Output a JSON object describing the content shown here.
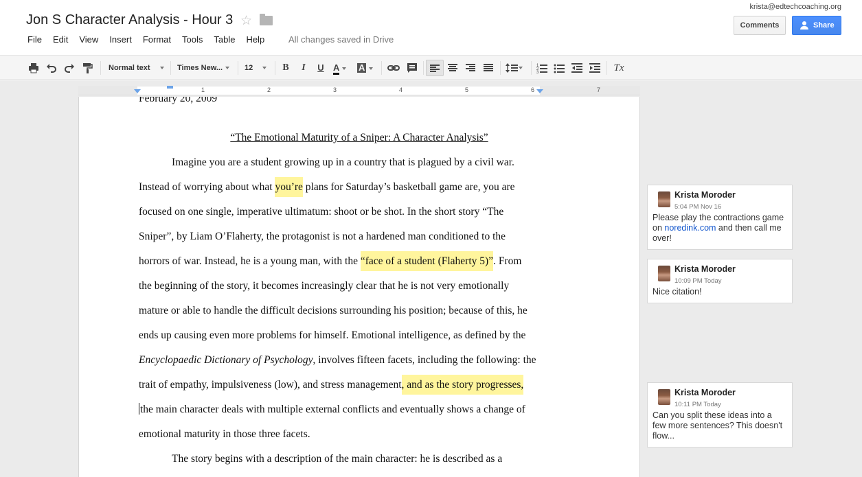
{
  "header": {
    "title": "Jon S Character Analysis - Hour 3",
    "account": "krista@edtechcoaching.org",
    "comments_label": "Comments",
    "share_label": "Share",
    "save_status": "All changes saved in Drive"
  },
  "menu": [
    "File",
    "Edit",
    "View",
    "Insert",
    "Format",
    "Tools",
    "Table",
    "Help"
  ],
  "toolbar": {
    "style": "Normal text",
    "font": "Times New...",
    "size": "12",
    "bold": "B",
    "italic": "I",
    "underline": "U",
    "text_color": "A",
    "highlight": "A",
    "clear_format": "Tx",
    "icons": [
      "print-icon",
      "undo-icon",
      "redo-icon",
      "paint-format-icon",
      "link-icon",
      "comment-icon",
      "align-left-icon",
      "align-center-icon",
      "align-right-icon",
      "justify-icon",
      "line-spacing-icon",
      "numbered-list-icon",
      "bulleted-list-icon",
      "decrease-indent-icon",
      "increase-indent-icon",
      "clear-formatting-icon",
      "collapse-icon"
    ]
  },
  "ruler": [
    "1",
    "2",
    "3",
    "4",
    "5",
    "6",
    "7"
  ],
  "document": {
    "date": "February 20, 2009",
    "title": "“The Emotional Maturity of a Sniper: A Character Analysis”",
    "lines": [
      {
        "pre": "Imagine you are a student growing up in a country that is plagued by a civil war.",
        "hl": "",
        "post": ""
      },
      {
        "pre": "Instead of worrying about what ",
        "hl": "you’re",
        "post": " plans for Saturday’s basketball game are, you are"
      },
      {
        "pre": "focused on one single, imperative ultimatum: shoot or be shot. In the short story “The",
        "hl": "",
        "post": ""
      },
      {
        "pre": "Sniper”, by Liam O’Flaherty, the protagonist is not a hardened man conditioned to the",
        "hl": "",
        "post": ""
      },
      {
        "pre": "horrors of war. Instead, he is a young man, with the ",
        "hl": "“face of a student (Flaherty 5)”",
        "post": ". From"
      },
      {
        "pre": "the beginning of the story, it becomes increasingly clear that he is not very emotionally",
        "hl": "",
        "post": ""
      },
      {
        "pre": "mature or able to handle the difficult decisions surrounding his position; because of this, he",
        "hl": "",
        "post": ""
      },
      {
        "pre": "ends up causing even more problems for himself. Emotional intelligence, as defined by the",
        "hl": "",
        "post": ""
      },
      {
        "pre": "",
        "hl": "",
        "post": ", involves fifteen facets, including the following: the",
        "italic": "Encyclopaedic Dictionary of Psychology"
      },
      {
        "pre": "trait of empathy, impulsiveness (low), and stress management",
        "hl": ", and as the story progresses,",
        "post": ""
      },
      {
        "pre": "the main character deals with multiple external conflicts and eventually shows a change of",
        "hl": "",
        "post": ""
      },
      {
        "pre": "emotional maturity in those three facets.",
        "hl": "",
        "post": ""
      },
      {
        "pre": "The story begins with a description of the main character: he is described as a",
        "hl": "",
        "post": ""
      }
    ]
  },
  "comments": [
    {
      "author": "Krista Moroder",
      "time": "5:04 PM Nov 16",
      "body_pre": "Please play the contractions game on ",
      "link": "noredink.com",
      "body_post": " and then call me over!"
    },
    {
      "author": "Krista Moroder",
      "time": "10:09 PM Today",
      "body_pre": "Nice citation!",
      "link": "",
      "body_post": ""
    },
    {
      "author": "Krista Moroder",
      "time": "10:11 PM Today",
      "body_pre": "Can you split these ideas into a few more sentences? This doesn't flow...",
      "link": "",
      "body_post": ""
    }
  ],
  "colors": {
    "highlight": "#fff59d",
    "share": "#4d90fe",
    "link": "#1155cc"
  }
}
